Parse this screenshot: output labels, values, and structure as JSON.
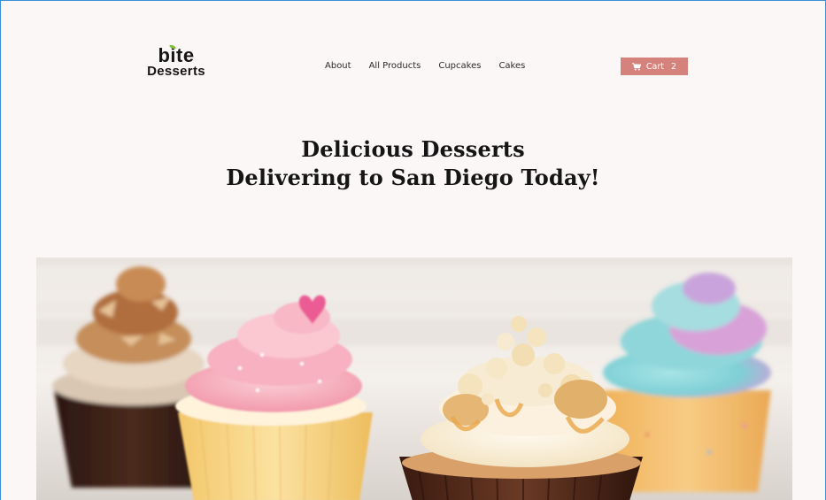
{
  "logo": {
    "line1": "bite",
    "line2": "Desserts"
  },
  "nav": {
    "items": [
      "About",
      "All Products",
      "Cupcakes",
      "Cakes"
    ]
  },
  "cart": {
    "label": "Cart",
    "count": "2"
  },
  "hero": {
    "line1": "Delicious Desserts",
    "line2": "Delivering to San Diego Today!"
  },
  "colors": {
    "background": "#fbf7f6",
    "cart_button": "#d4827b",
    "text": "#151515"
  },
  "icons": {
    "cart": "shopping-cart-icon",
    "leaf": "leaf-icon"
  }
}
